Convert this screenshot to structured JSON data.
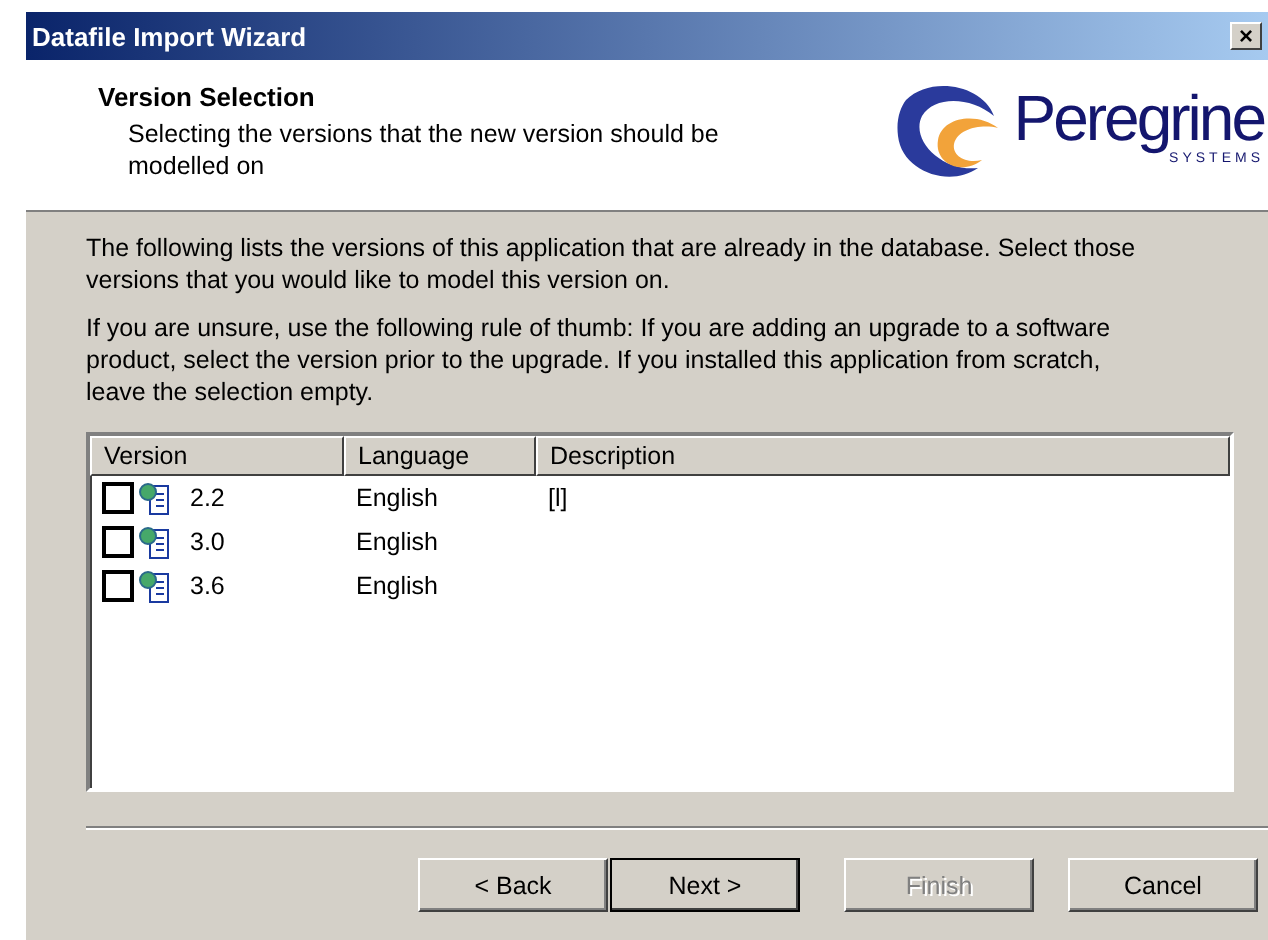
{
  "window": {
    "title": "Datafile Import Wizard",
    "close": "×"
  },
  "header": {
    "title": "Version Selection",
    "subtitle": "Selecting the versions that the new version should be modelled on",
    "logo_name": "Peregrine",
    "logo_tagline": "SYSTEMS"
  },
  "paragraphs": [
    "The following lists the versions of this application that are already in the database.  Select those versions that you would like to model this version on.",
    "If you are unsure, use the following rule of thumb: If you are adding an upgrade to a software product, select the version prior to the upgrade.  If you installed this application from scratch, leave the selection empty."
  ],
  "table": {
    "columns": [
      "Version",
      "Language",
      "Description"
    ],
    "rows": [
      {
        "version": "2.2",
        "language": "English",
        "description": "[l]",
        "checked": false
      },
      {
        "version": "3.0",
        "language": "English",
        "description": "",
        "checked": false
      },
      {
        "version": "3.6",
        "language": "English",
        "description": "",
        "checked": false
      }
    ]
  },
  "buttons": [
    {
      "label": "< Back",
      "disabled": false,
      "default": false
    },
    {
      "label": "Next >",
      "disabled": false,
      "default": true
    },
    {
      "label": "Finish",
      "disabled": true,
      "default": false
    },
    {
      "label": "Cancel",
      "disabled": false,
      "default": false
    }
  ]
}
